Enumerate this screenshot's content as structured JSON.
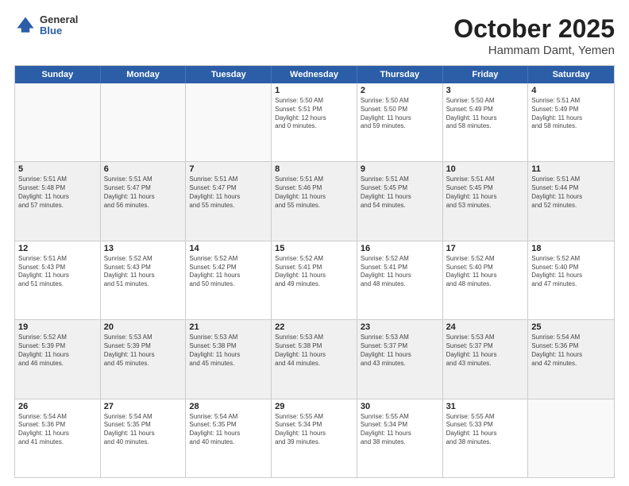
{
  "logo": {
    "line1": "General",
    "line2": "Blue"
  },
  "title": "October 2025",
  "subtitle": "Hammam Damt, Yemen",
  "header_days": [
    "Sunday",
    "Monday",
    "Tuesday",
    "Wednesday",
    "Thursday",
    "Friday",
    "Saturday"
  ],
  "rows": [
    [
      {
        "day": "",
        "text": ""
      },
      {
        "day": "",
        "text": ""
      },
      {
        "day": "",
        "text": ""
      },
      {
        "day": "1",
        "text": "Sunrise: 5:50 AM\nSunset: 5:51 PM\nDaylight: 12 hours\nand 0 minutes."
      },
      {
        "day": "2",
        "text": "Sunrise: 5:50 AM\nSunset: 5:50 PM\nDaylight: 11 hours\nand 59 minutes."
      },
      {
        "day": "3",
        "text": "Sunrise: 5:50 AM\nSunset: 5:49 PM\nDaylight: 11 hours\nand 58 minutes."
      },
      {
        "day": "4",
        "text": "Sunrise: 5:51 AM\nSunset: 5:49 PM\nDaylight: 11 hours\nand 58 minutes."
      }
    ],
    [
      {
        "day": "5",
        "text": "Sunrise: 5:51 AM\nSunset: 5:48 PM\nDaylight: 11 hours\nand 57 minutes."
      },
      {
        "day": "6",
        "text": "Sunrise: 5:51 AM\nSunset: 5:47 PM\nDaylight: 11 hours\nand 56 minutes."
      },
      {
        "day": "7",
        "text": "Sunrise: 5:51 AM\nSunset: 5:47 PM\nDaylight: 11 hours\nand 55 minutes."
      },
      {
        "day": "8",
        "text": "Sunrise: 5:51 AM\nSunset: 5:46 PM\nDaylight: 11 hours\nand 55 minutes."
      },
      {
        "day": "9",
        "text": "Sunrise: 5:51 AM\nSunset: 5:45 PM\nDaylight: 11 hours\nand 54 minutes."
      },
      {
        "day": "10",
        "text": "Sunrise: 5:51 AM\nSunset: 5:45 PM\nDaylight: 11 hours\nand 53 minutes."
      },
      {
        "day": "11",
        "text": "Sunrise: 5:51 AM\nSunset: 5:44 PM\nDaylight: 11 hours\nand 52 minutes."
      }
    ],
    [
      {
        "day": "12",
        "text": "Sunrise: 5:51 AM\nSunset: 5:43 PM\nDaylight: 11 hours\nand 51 minutes."
      },
      {
        "day": "13",
        "text": "Sunrise: 5:52 AM\nSunset: 5:43 PM\nDaylight: 11 hours\nand 51 minutes."
      },
      {
        "day": "14",
        "text": "Sunrise: 5:52 AM\nSunset: 5:42 PM\nDaylight: 11 hours\nand 50 minutes."
      },
      {
        "day": "15",
        "text": "Sunrise: 5:52 AM\nSunset: 5:41 PM\nDaylight: 11 hours\nand 49 minutes."
      },
      {
        "day": "16",
        "text": "Sunrise: 5:52 AM\nSunset: 5:41 PM\nDaylight: 11 hours\nand 48 minutes."
      },
      {
        "day": "17",
        "text": "Sunrise: 5:52 AM\nSunset: 5:40 PM\nDaylight: 11 hours\nand 48 minutes."
      },
      {
        "day": "18",
        "text": "Sunrise: 5:52 AM\nSunset: 5:40 PM\nDaylight: 11 hours\nand 47 minutes."
      }
    ],
    [
      {
        "day": "19",
        "text": "Sunrise: 5:52 AM\nSunset: 5:39 PM\nDaylight: 11 hours\nand 46 minutes."
      },
      {
        "day": "20",
        "text": "Sunrise: 5:53 AM\nSunset: 5:39 PM\nDaylight: 11 hours\nand 45 minutes."
      },
      {
        "day": "21",
        "text": "Sunrise: 5:53 AM\nSunset: 5:38 PM\nDaylight: 11 hours\nand 45 minutes."
      },
      {
        "day": "22",
        "text": "Sunrise: 5:53 AM\nSunset: 5:38 PM\nDaylight: 11 hours\nand 44 minutes."
      },
      {
        "day": "23",
        "text": "Sunrise: 5:53 AM\nSunset: 5:37 PM\nDaylight: 11 hours\nand 43 minutes."
      },
      {
        "day": "24",
        "text": "Sunrise: 5:53 AM\nSunset: 5:37 PM\nDaylight: 11 hours\nand 43 minutes."
      },
      {
        "day": "25",
        "text": "Sunrise: 5:54 AM\nSunset: 5:36 PM\nDaylight: 11 hours\nand 42 minutes."
      }
    ],
    [
      {
        "day": "26",
        "text": "Sunrise: 5:54 AM\nSunset: 5:36 PM\nDaylight: 11 hours\nand 41 minutes."
      },
      {
        "day": "27",
        "text": "Sunrise: 5:54 AM\nSunset: 5:35 PM\nDaylight: 11 hours\nand 40 minutes."
      },
      {
        "day": "28",
        "text": "Sunrise: 5:54 AM\nSunset: 5:35 PM\nDaylight: 11 hours\nand 40 minutes."
      },
      {
        "day": "29",
        "text": "Sunrise: 5:55 AM\nSunset: 5:34 PM\nDaylight: 11 hours\nand 39 minutes."
      },
      {
        "day": "30",
        "text": "Sunrise: 5:55 AM\nSunset: 5:34 PM\nDaylight: 11 hours\nand 38 minutes."
      },
      {
        "day": "31",
        "text": "Sunrise: 5:55 AM\nSunset: 5:33 PM\nDaylight: 11 hours\nand 38 minutes."
      },
      {
        "day": "",
        "text": ""
      }
    ]
  ],
  "shaded_rows": [
    1,
    3
  ],
  "colors": {
    "header_bg": "#2b5ea7",
    "header_text": "#ffffff",
    "shaded_cell": "#f0f0f0"
  }
}
